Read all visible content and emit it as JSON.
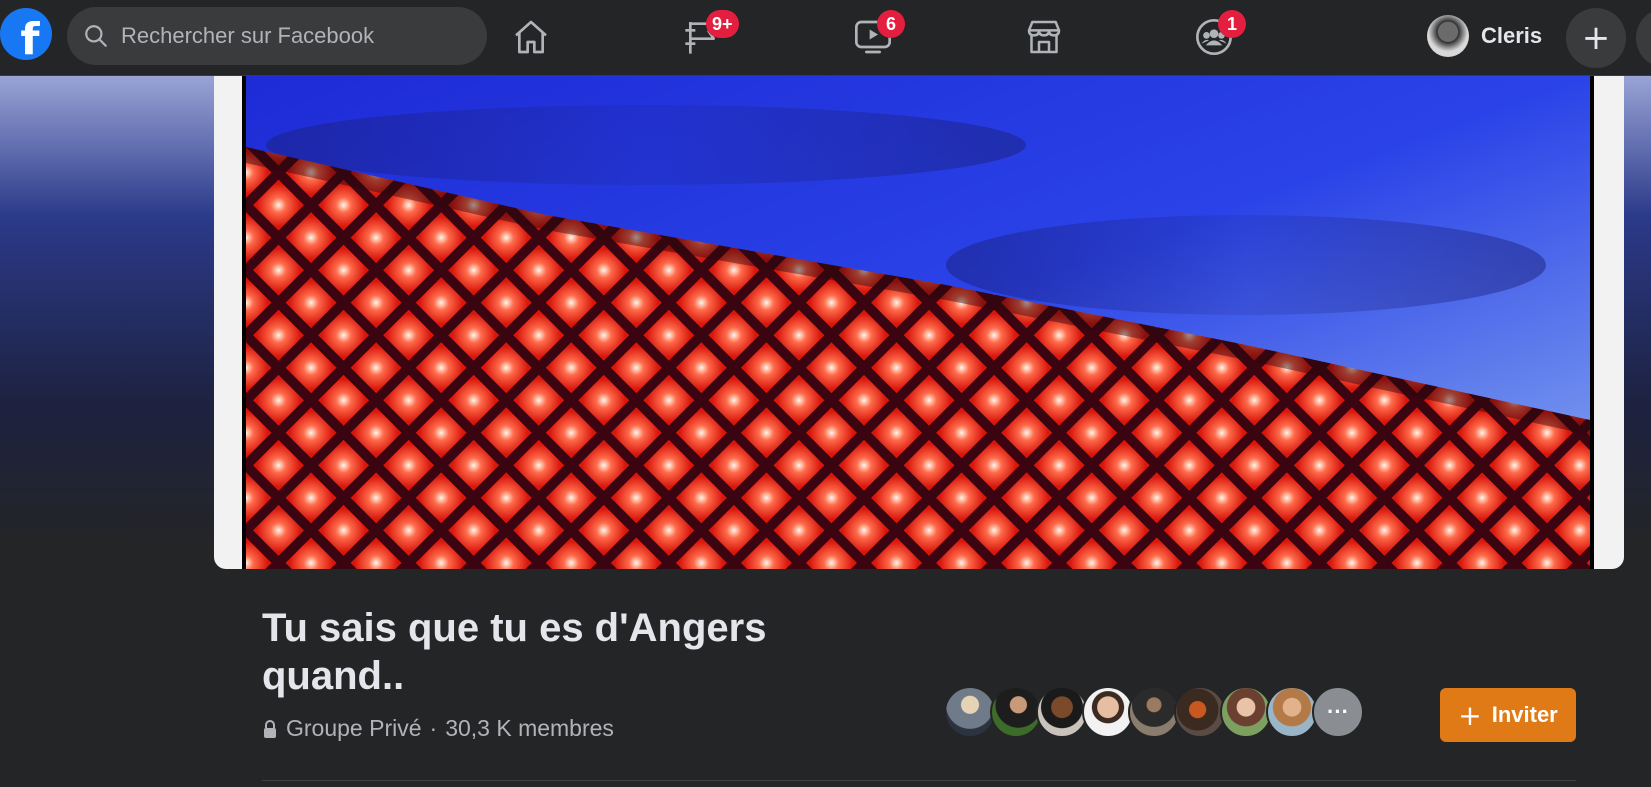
{
  "search": {
    "placeholder": "Rechercher sur Facebook",
    "icon": "search-icon"
  },
  "nav": [
    {
      "name": "home",
      "icon": "home-icon",
      "badge": ""
    },
    {
      "name": "pages",
      "icon": "flag-icon",
      "badge": "9+"
    },
    {
      "name": "watch",
      "icon": "video-icon",
      "badge": "6"
    },
    {
      "name": "marketplace",
      "icon": "store-icon",
      "badge": ""
    },
    {
      "name": "groups",
      "icon": "groups-icon",
      "badge": "1"
    }
  ],
  "profile": {
    "name": "Cleris"
  },
  "create_button": {
    "label": "+"
  },
  "group": {
    "title": "Tu sais que tu es d'Angers quand..",
    "privacy": "Groupe Privé",
    "separator": "·",
    "members": "30,3 K membres",
    "more_members": "···"
  },
  "invite": {
    "plus": "+",
    "label": "Inviter"
  },
  "colors": {
    "accent_blue": "#1877f2",
    "badge_red": "#e41e3f",
    "invite_orange": "#e07a16",
    "bar_bg": "#242526"
  }
}
